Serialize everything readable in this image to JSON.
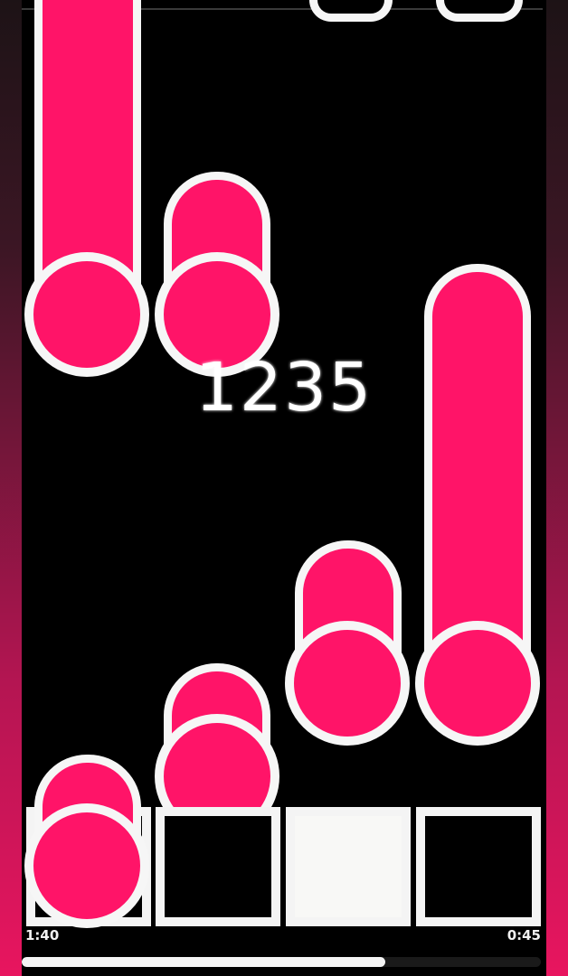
{
  "game": {
    "score": "1235",
    "time_elapsed": "1:40",
    "time_remaining": "0:45",
    "progress_fraction": 0.7
  },
  "colors": {
    "note": "#ff1468",
    "outline": "#f6f6f6",
    "field": "#000000",
    "side_gradient_bottom": "#e8155f"
  },
  "lanes": [
    {
      "lane": 1,
      "pad_state": "idle"
    },
    {
      "lane": 2,
      "pad_state": "idle"
    },
    {
      "lane": 3,
      "pad_state": "pressed"
    },
    {
      "lane": 4,
      "pad_state": "idle"
    }
  ]
}
